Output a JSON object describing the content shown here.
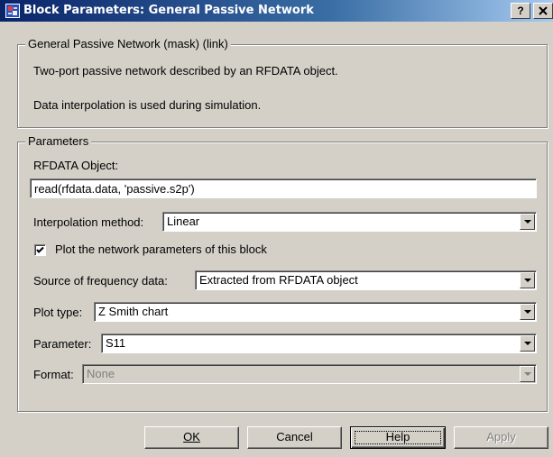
{
  "window": {
    "title": "Block Parameters: General Passive Network",
    "help_glyph": "?",
    "close_glyph": "X"
  },
  "mask_group": {
    "legend": "General Passive Network (mask) (link)",
    "description_1": "Two-port passive network described by an RFDATA object.",
    "description_2": "Data interpolation is used during simulation."
  },
  "params_group": {
    "legend": "Parameters",
    "rfdata_label": "RFDATA Object:",
    "rfdata_value": "read(rfdata.data, 'passive.s2p')",
    "interp_label": "Interpolation method:",
    "interp_value": "Linear",
    "plot_checkbox_label": "Plot the network parameters of this block",
    "plot_checked": true,
    "freq_label": "Source of frequency data:",
    "freq_value": "Extracted from RFDATA object",
    "plottype_label": "Plot type:",
    "plottype_value": "Z Smith chart",
    "parameter_label": "Parameter:",
    "parameter_value": "S11",
    "format_label": "Format:",
    "format_value": "None"
  },
  "buttons": {
    "ok": "OK",
    "cancel": "Cancel",
    "help": "Help",
    "apply": "Apply"
  },
  "colors": {
    "title_start": "#0a246a",
    "title_end": "#a6caf0",
    "face": "#d4d0c8"
  },
  "icons": {
    "title": "simulink-block-icon",
    "close": "close-icon",
    "check": "check-icon",
    "dropdown": "chevron-down-icon"
  }
}
